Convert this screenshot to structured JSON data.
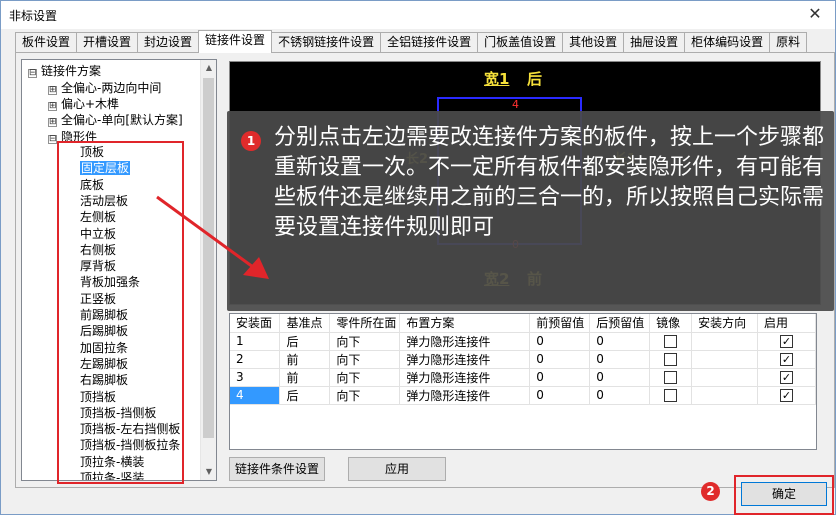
{
  "window": {
    "title": "非标设置",
    "close_glyph": "✕"
  },
  "tabs": [
    {
      "label": "板件设置"
    },
    {
      "label": "开槽设置"
    },
    {
      "label": "封边设置"
    },
    {
      "label": "链接件设置",
      "active": true
    },
    {
      "label": "不锈钢链接件设置"
    },
    {
      "label": "全铝链接件设置"
    },
    {
      "label": "门板盖值设置"
    },
    {
      "label": "其他设置"
    },
    {
      "label": "抽屉设置"
    },
    {
      "label": "柜体编码设置"
    },
    {
      "label": "原料"
    }
  ],
  "tree": {
    "root": {
      "label": "链接件方案",
      "expander": "⊟"
    },
    "groups": [
      {
        "label": "全偏心-两边向中间",
        "expander": "⊞"
      },
      {
        "label": "偏心+木榫",
        "expander": "⊞"
      },
      {
        "label": "全偏心-单向[默认方案]",
        "expander": "⊞"
      },
      {
        "label": "隐形件",
        "expander": "⊟"
      }
    ],
    "children": [
      "顶板",
      "固定层板",
      "底板",
      "活动层板",
      "左侧板",
      "中立板",
      "右侧板",
      "厚背板",
      "背板加强条",
      "正竖板",
      "前踢脚板",
      "后踢脚板",
      "加固拉条",
      "左踢脚板",
      "右踢脚板",
      "顶挡板",
      "顶挡板-挡侧板",
      "顶挡板-左右挡侧板",
      "顶挡板-挡侧板拉条",
      "顶拉条-横装",
      "顶拉条-竖装"
    ],
    "selected_index": 1,
    "scroll_up": "▲",
    "scroll_down": "▼"
  },
  "preview": {
    "top_label_a": "宽1",
    "top_label_b": "后",
    "bottom_label_a": "宽2",
    "bottom_label_b": "前",
    "left_label": "长2",
    "right_label": "长1",
    "edge_top": "4",
    "edge_bottom": "0"
  },
  "callout": {
    "badge": "1",
    "text": "分别点击左边需要改连接件方案的板件，按上一个步骤都重新设置一次。不一定所有板件都安装隐形件，有可能有些板件还是继续用之前的三合一的，所以按照自己实际需要设置连接件规则即可"
  },
  "table": {
    "headers": [
      "安装面",
      "基准点",
      "零件所在面",
      "布置方案",
      "前预留值",
      "后预留值",
      "镜像",
      "安装方向",
      "启用"
    ],
    "rows": [
      {
        "face": "1",
        "ref": "后",
        "side": "向下",
        "plan": "弹力隐形连接件",
        "front": "0",
        "back": "0",
        "mirror": false,
        "dir": "",
        "enabled": true
      },
      {
        "face": "2",
        "ref": "前",
        "side": "向下",
        "plan": "弹力隐形连接件",
        "front": "0",
        "back": "0",
        "mirror": false,
        "dir": "",
        "enabled": true
      },
      {
        "face": "3",
        "ref": "前",
        "side": "向下",
        "plan": "弹力隐形连接件",
        "front": "0",
        "back": "0",
        "mirror": false,
        "dir": "",
        "enabled": true
      },
      {
        "face": "4",
        "ref": "后",
        "side": "向下",
        "plan": "弹力隐形连接件",
        "front": "0",
        "back": "0",
        "mirror": false,
        "dir": "",
        "enabled": true
      }
    ],
    "selected_row": 3,
    "check_glyph": "✓"
  },
  "buttons": {
    "condition": "链接件条件设置",
    "apply": "应用",
    "ok": "确定",
    "ok_badge": "2"
  },
  "colors": {
    "highlight_red": "#e0252a",
    "selection_blue": "#3399ff",
    "preview_yellow": "#f5e03a",
    "preview_rect_blue": "#2a2aff"
  }
}
